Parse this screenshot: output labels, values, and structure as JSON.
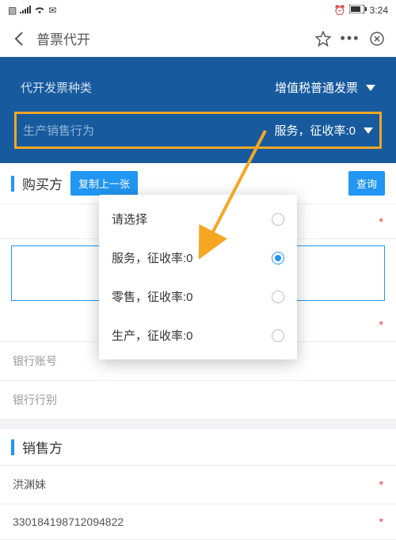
{
  "status": {
    "time": "3:24"
  },
  "nav": {
    "title": "普票代开"
  },
  "banner": {
    "row1": {
      "label": "代开发票种类",
      "value": "增值税普通发票"
    },
    "row2": {
      "label": "生产销售行为",
      "value": "服务，征收率:0"
    }
  },
  "buyer": {
    "title": "购买方",
    "copy_btn": "复制上一张",
    "query_btn": "查询",
    "bank_account": "银行账号",
    "bank_branch": "银行行别"
  },
  "seller": {
    "title": "销售方",
    "name": "洪渊妹",
    "number": "330184198712094822"
  },
  "modal": {
    "options": [
      {
        "label": "请选择",
        "selected": false
      },
      {
        "label": "服务，征收率:0",
        "selected": true
      },
      {
        "label": "零售，征收率:0",
        "selected": false
      },
      {
        "label": "生产，征收率:0",
        "selected": false
      }
    ]
  }
}
